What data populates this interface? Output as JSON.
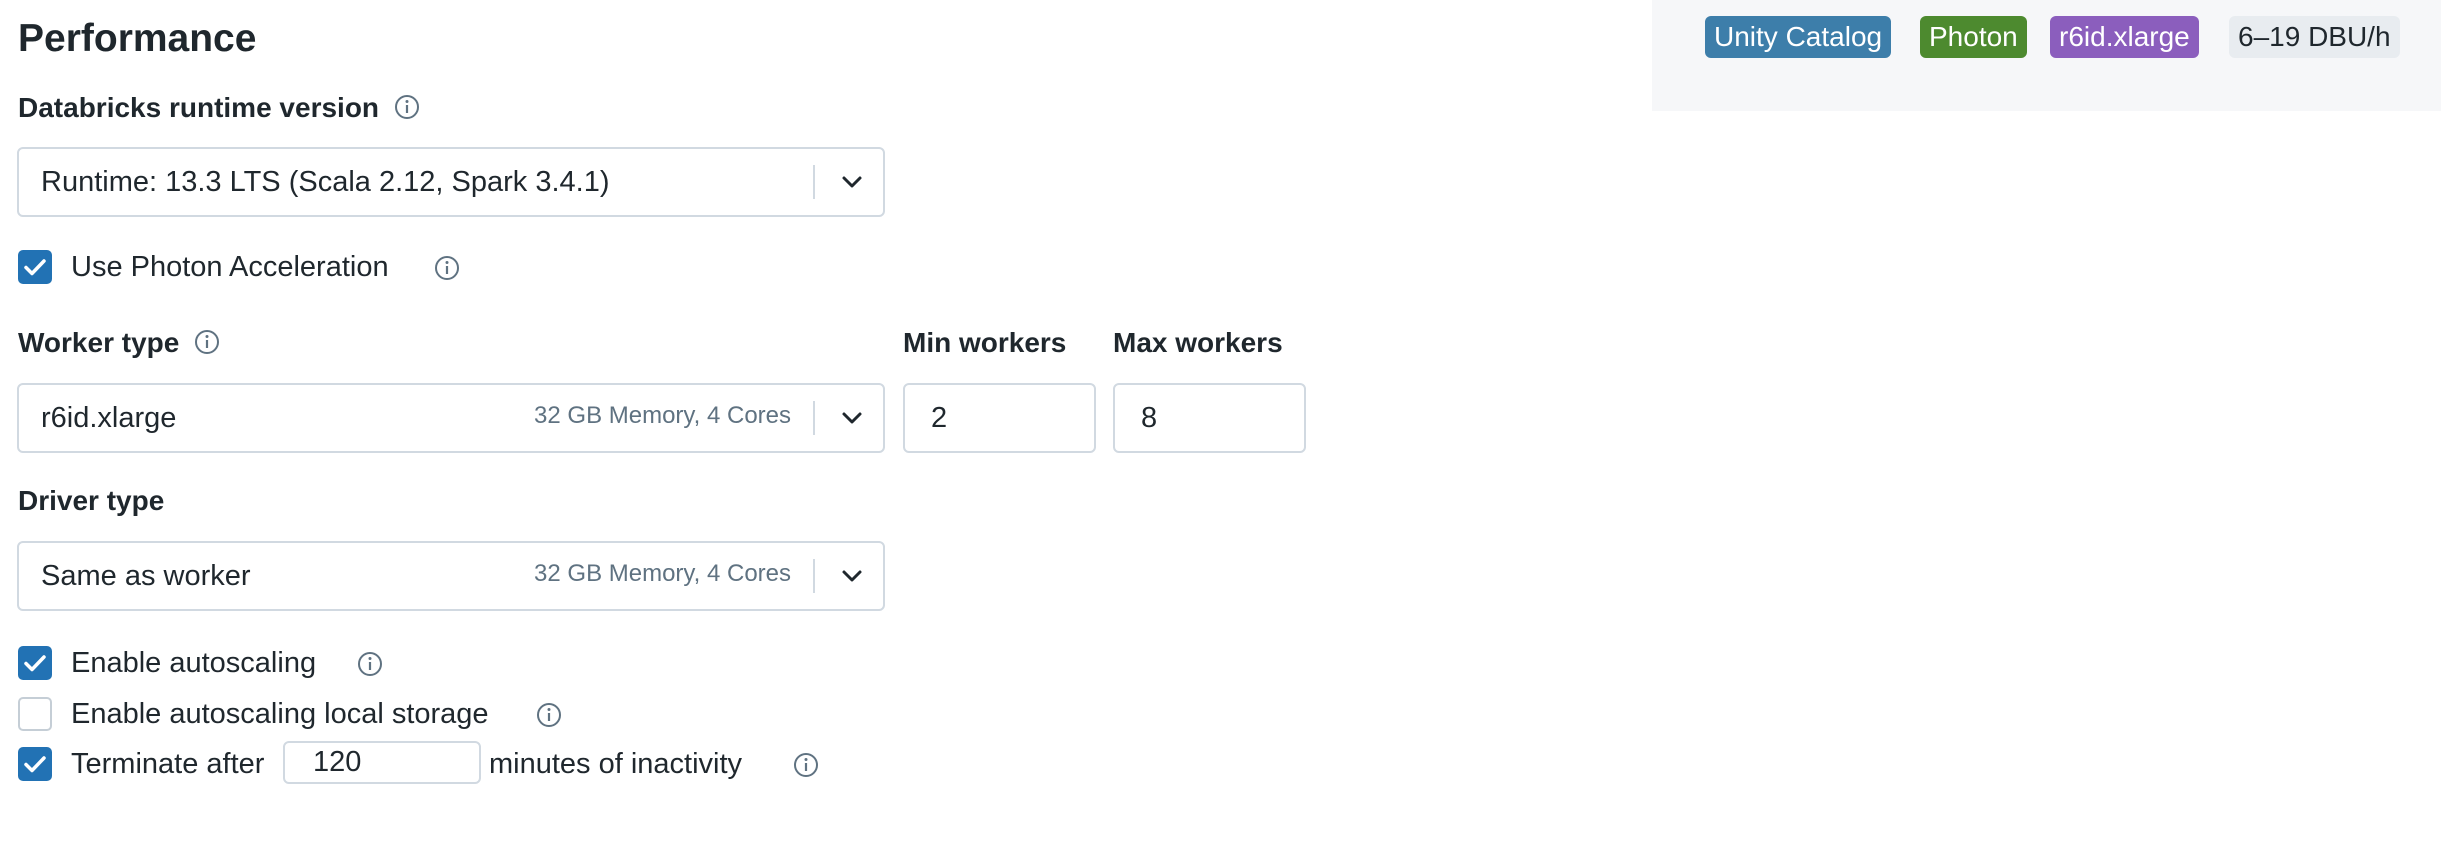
{
  "section": {
    "title": "Performance"
  },
  "runtime": {
    "label": "Databricks runtime version",
    "value": "Runtime: 13.3 LTS (Scala 2.12, Spark 3.4.1)"
  },
  "photon": {
    "label": "Use Photon Acceleration",
    "checked": true
  },
  "worker": {
    "label": "Worker type",
    "value": "r6id.xlarge",
    "hint": "32 GB Memory, 4 Cores"
  },
  "min_workers": {
    "label": "Min workers",
    "value": "2"
  },
  "max_workers": {
    "label": "Max workers",
    "value": "8"
  },
  "driver": {
    "label": "Driver type",
    "value": "Same as worker",
    "hint": "32 GB Memory, 4 Cores"
  },
  "options": {
    "autoscaling": {
      "label": "Enable autoscaling",
      "checked": true
    },
    "local_storage": {
      "label": "Enable autoscaling local storage",
      "checked": false
    },
    "terminate": {
      "prefix": "Terminate after",
      "minutes": "120",
      "suffix": "minutes of inactivity",
      "checked": true
    }
  },
  "summary": {
    "badges": [
      {
        "label": "Unity Catalog",
        "color": "#3d7eaa"
      },
      {
        "label": "Photon",
        "color": "#4d8a2f"
      },
      {
        "label": "r6id.xlarge",
        "color": "#8b5ebd"
      }
    ],
    "dbu": "6–19 DBU/h"
  },
  "colors": {
    "accent": "#2272b4",
    "border": "#d1d9e1",
    "hint": "#5f7281"
  }
}
